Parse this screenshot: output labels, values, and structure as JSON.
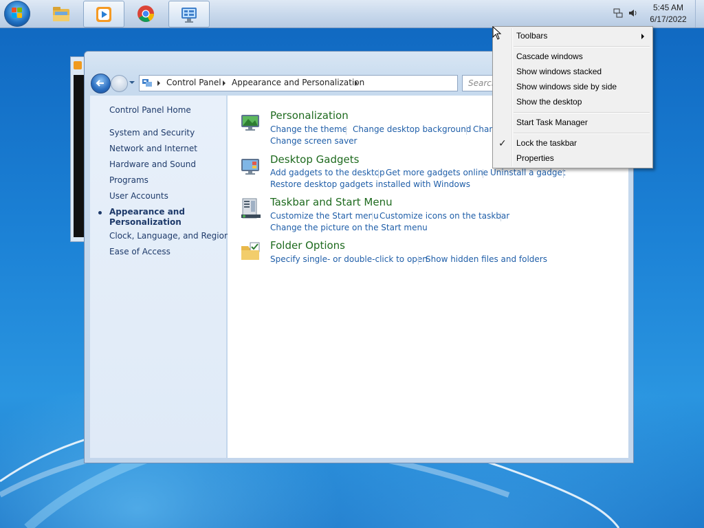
{
  "taskbar": {
    "clock_time": "5:45 AM",
    "clock_date": "6/17/2022",
    "apps": [
      {
        "name": "Windows Explorer",
        "icon": "explorer-icon"
      },
      {
        "name": "Windows Media Player",
        "icon": "media-player-icon"
      },
      {
        "name": "Google Chrome",
        "icon": "chrome-icon"
      },
      {
        "name": "Control Panel",
        "icon": "control-panel-icon"
      }
    ]
  },
  "window": {
    "breadcrumb": [
      "Control Panel",
      "Appearance and Personalization"
    ],
    "search_placeholder": "Search Control Panel",
    "search_visible": "Search"
  },
  "left_nav": {
    "home": "Control Panel Home",
    "items": [
      "System and Security",
      "Network and Internet",
      "Hardware and Sound",
      "Programs",
      "User Accounts",
      "Appearance and Personalization",
      "Clock, Language, and Region",
      "Ease of Access"
    ],
    "current_line1": "Appearance and",
    "current_line2": "Personalization"
  },
  "categories": {
    "personalization": {
      "title": "Personalization",
      "tasks": [
        "Change the theme",
        "Change desktop background",
        "Chan",
        "Change screen saver"
      ]
    },
    "gadgets": {
      "title": "Desktop Gadgets",
      "tasks": [
        "Add gadgets to the desktop",
        "Get more gadgets online",
        "Uninstall a gadget",
        "Restore desktop gadgets installed with Windows"
      ]
    },
    "taskbar_start": {
      "title": "Taskbar and Start Menu",
      "tasks": [
        "Customize the Start menu",
        "Customize icons on the taskbar",
        "Change the picture on the Start menu"
      ]
    },
    "folder_options": {
      "title": "Folder Options",
      "tasks": [
        "Specify single- or double-click to open",
        "Show hidden files and folders"
      ]
    }
  },
  "context_menu": {
    "toolbars": "Toolbars",
    "cascade": "Cascade windows",
    "stacked": "Show windows stacked",
    "side_by_side": "Show windows side by side",
    "show_desktop": "Show the desktop",
    "task_manager": "Start Task Manager",
    "lock_taskbar": "Lock the taskbar",
    "lock_taskbar_checked": true,
    "properties": "Properties"
  },
  "colors": {
    "link": "#1f5ea8",
    "category_title": "#1e6a1e",
    "nav_text": "#1e3a6a"
  }
}
